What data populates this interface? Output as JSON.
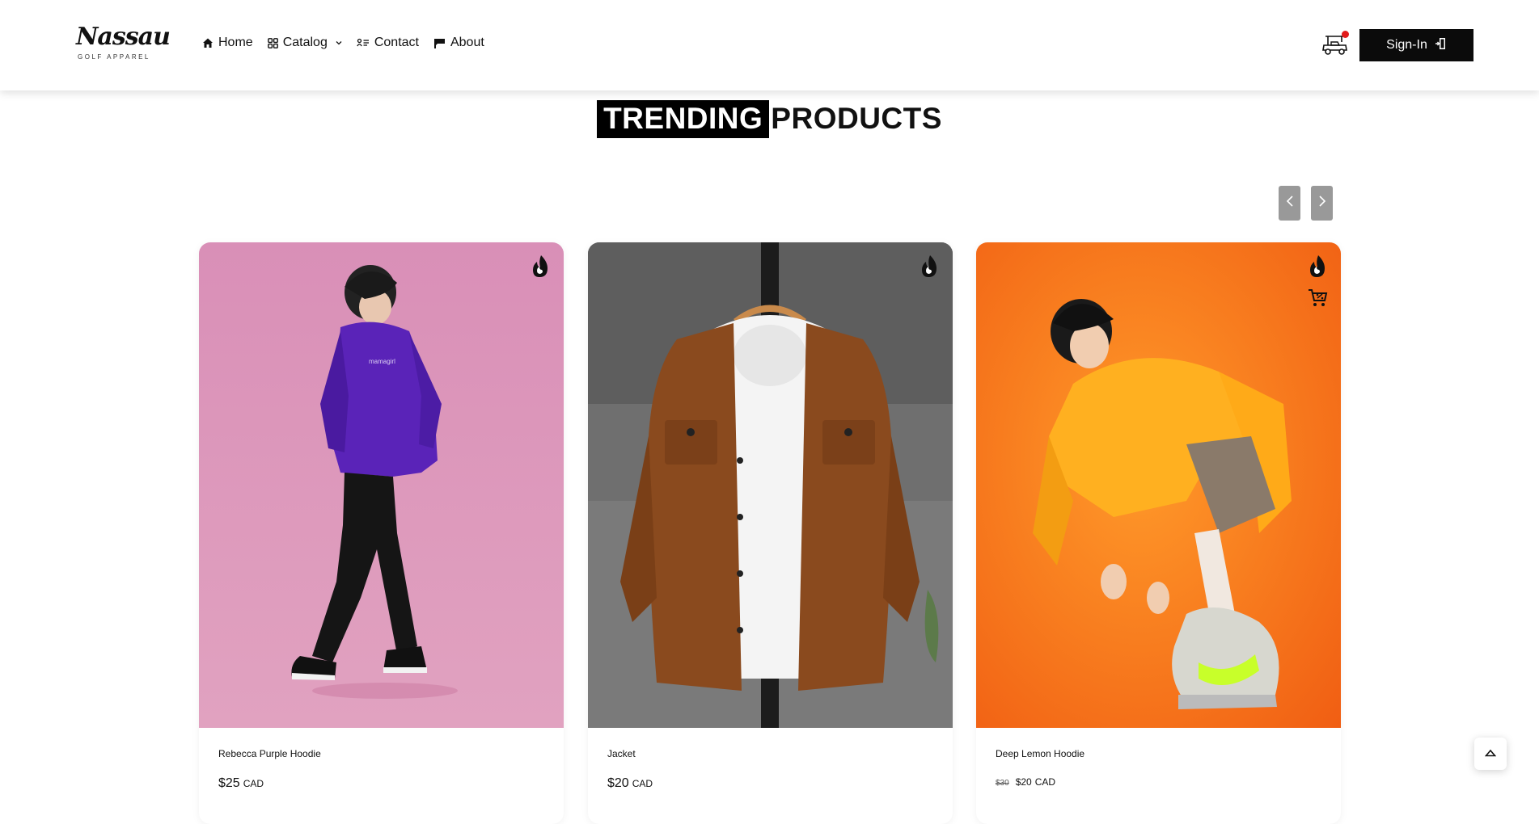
{
  "brand": {
    "logo_script": "Nassau",
    "logo_sub": "GOLF APPAREL"
  },
  "nav": {
    "home": "Home",
    "catalog": "Catalog",
    "contact": "Contact",
    "about": "About"
  },
  "header": {
    "signin_label": "Sign-In"
  },
  "section": {
    "title_highlight": "TRENDING",
    "title_rest": "PRODUCTS"
  },
  "products": [
    {
      "name": "Rebecca Purple Hoodie",
      "price": "$25",
      "currency": "CAD",
      "badge": "flame-icon"
    },
    {
      "name": "Jacket",
      "price": "$20",
      "currency": "CAD",
      "badge": "flame-icon"
    },
    {
      "name": "Deep Lemon Hoodie",
      "old_price": "$30",
      "price": "$20",
      "currency": "CAD",
      "badge": "flame-icon"
    }
  ],
  "colors": {
    "accent": "#000000",
    "cart_dot": "#e21b1b",
    "arrow_bg": "#999999"
  }
}
